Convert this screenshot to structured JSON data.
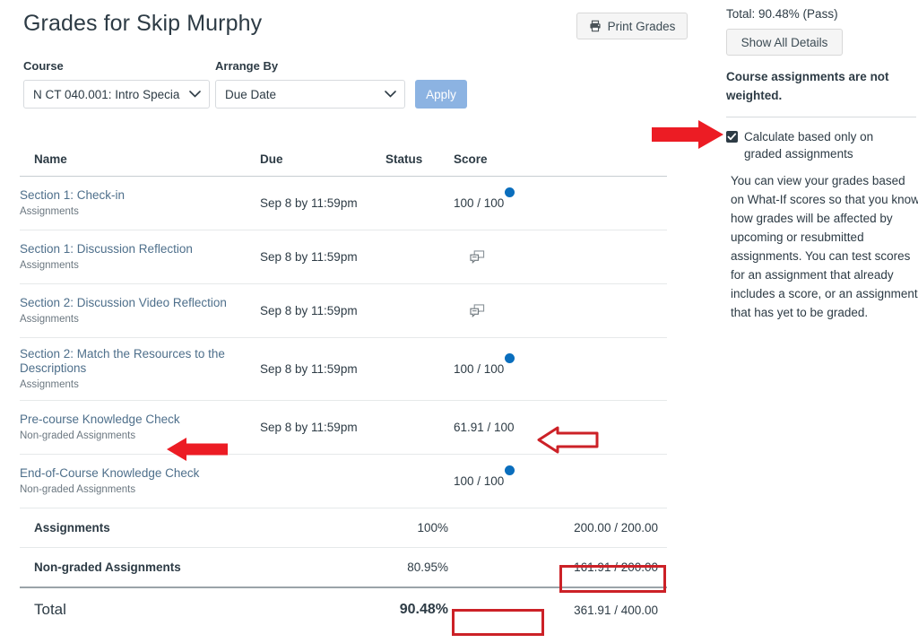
{
  "header": {
    "title": "Grades for Skip Murphy",
    "print_button": "Print Grades",
    "printer_icon": "printer-icon"
  },
  "filters": {
    "course_label": "Course",
    "arrange_label": "Arrange By",
    "course_value": "N CT 040.001: Intro Specia",
    "arrange_value": "Due Date",
    "apply_label": "Apply",
    "chevron_icon": "chevron-down-icon"
  },
  "table": {
    "columns": [
      "Name",
      "Due",
      "Status",
      "Score"
    ],
    "rows": [
      {
        "name": "Section 1: Check-in",
        "group": "Assignments",
        "due": "Sep 8 by 11:59pm",
        "status": "",
        "score": "100 / 100",
        "icon": "unread-dot"
      },
      {
        "name": "Section 1: Discussion Reflection",
        "group": "Assignments",
        "due": "Sep 8 by 11:59pm",
        "status": "",
        "score": "",
        "icon": "discussion-icon"
      },
      {
        "name": "Section 2: Discussion Video Reflection",
        "group": "Assignments",
        "due": "Sep 8 by 11:59pm",
        "status": "",
        "score": "",
        "icon": "discussion-icon"
      },
      {
        "name": "Section 2: Match the Resources to the Descriptions",
        "group": "Assignments",
        "due": "Sep 8 by 11:59pm",
        "status": "",
        "score": "100 / 100",
        "icon": "unread-dot"
      },
      {
        "name": "Pre-course Knowledge Check",
        "group": "Non-graded Assignments",
        "due": "Sep 8 by 11:59pm",
        "status": "",
        "score": "61.91 / 100",
        "icon": "none"
      },
      {
        "name": "End-of-Course Knowledge Check",
        "group": "Non-graded Assignments",
        "due": "",
        "status": "",
        "score": "100 / 100",
        "icon": "unread-dot"
      }
    ],
    "summary": [
      {
        "name": "Assignments",
        "percent": "100%",
        "score": "200.00 / 200.00"
      },
      {
        "name": "Non-graded Assignments",
        "percent": "80.95%",
        "score": "161.91 / 200.00"
      }
    ],
    "total": {
      "name": "Total",
      "percent": "90.48%",
      "score": "361.91 / 400.00"
    }
  },
  "sidebar": {
    "total_line": "Total: 90.48% (Pass)",
    "show_details_button": "Show All Details",
    "weight_note": "Course assignments are not weighted.",
    "calculate_checkbox_label": "Calculate based only on graded assignments",
    "checkbox_checked": true,
    "whatif_text": "You can view your grades based on What-If scores so that you know how grades will be affected by upcoming or resubmitted assignments. You can test scores for an assignment that already includes a score, or an assignment that has yet to be graded."
  },
  "annotations": {
    "arrow_to_checkbox": "red-solid-right-arrow",
    "arrow_to_nongraded_label": "red-solid-left-arrow",
    "arrow_to_precourse_score": "red-outline-left-arrow",
    "highlight_nongraded_score": "red-box",
    "highlight_total_percent": "red-box",
    "accent_color": "#cc2127"
  }
}
